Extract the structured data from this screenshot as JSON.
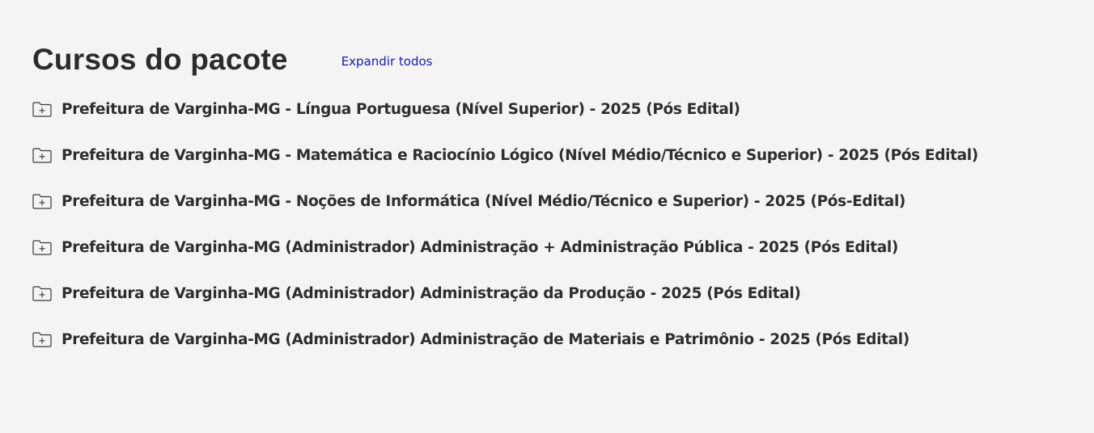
{
  "header": {
    "title": "Cursos do pacote",
    "expand_all_label": "Expandir todos"
  },
  "courses": [
    {
      "icon": "folder-plus-icon",
      "title": "Prefeitura de Varginha-MG - Língua Portuguesa (Nível Superior) - 2025 (Pós Edital)"
    },
    {
      "icon": "folder-plus-icon",
      "title": "Prefeitura de Varginha-MG - Matemática e Raciocínio Lógico (Nível Médio/Técnico e Superior) - 2025 (Pós Edital)"
    },
    {
      "icon": "folder-plus-icon",
      "title": "Prefeitura de Varginha-MG - Noções de Informática (Nível Médio/Técnico e Superior) - 2025 (Pós-Edital)"
    },
    {
      "icon": "folder-plus-icon",
      "title": "Prefeitura de Varginha-MG (Administrador) Administração + Administração Pública - 2025 (Pós Edital)"
    },
    {
      "icon": "folder-plus-icon",
      "title": "Prefeitura de Varginha-MG (Administrador) Administração da Produção - 2025 (Pós Edital)"
    },
    {
      "icon": "folder-plus-icon",
      "title": "Prefeitura de Varginha-MG (Administrador) Administração de Materiais e Patrimônio - 2025 (Pós Edital)"
    }
  ],
  "colors": {
    "background": "#f4f4f4",
    "text": "#2e2e2e",
    "link": "#1a1aa8"
  }
}
